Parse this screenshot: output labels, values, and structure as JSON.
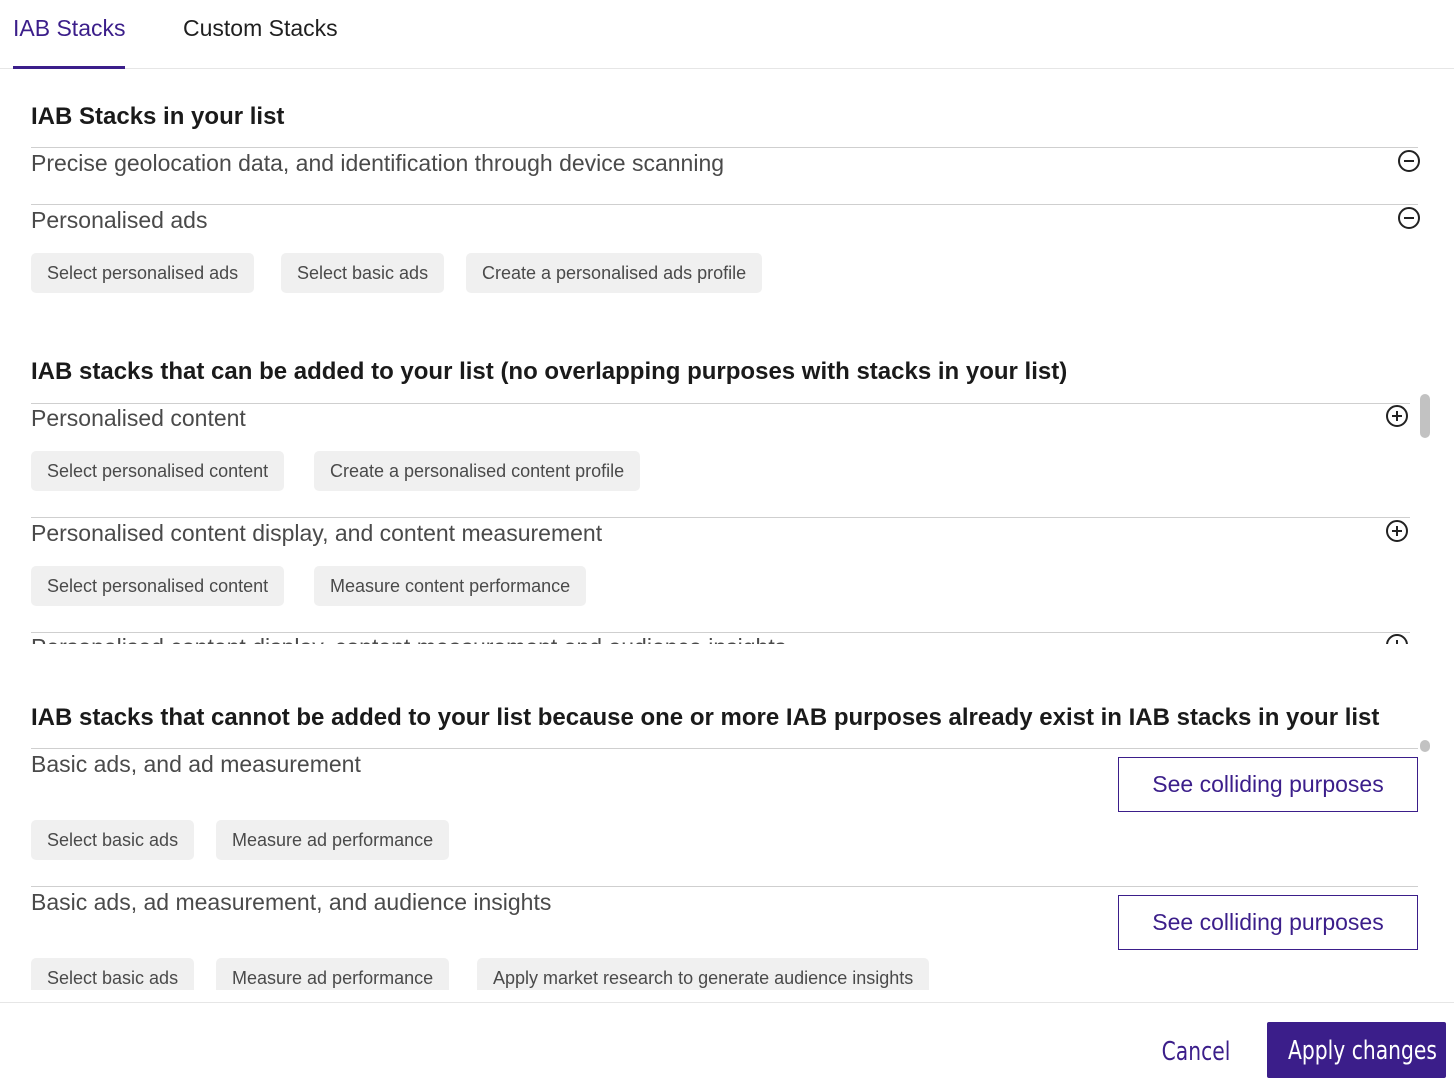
{
  "tabs": [
    {
      "label": "IAB Stacks",
      "active": true
    },
    {
      "label": "Custom Stacks",
      "active": false
    }
  ],
  "in_list": {
    "title": "IAB Stacks in your list",
    "stacks": [
      {
        "name": "Precise geolocation data, and identification through device scanning",
        "action_icon": "minus-circle-icon",
        "purposes": []
      },
      {
        "name": "Personalised ads",
        "action_icon": "minus-circle-icon",
        "purposes": [
          "Select personalised ads",
          "Select basic ads",
          "Create a personalised ads profile"
        ]
      }
    ]
  },
  "can_add": {
    "title": "IAB stacks that can be added to your list (no overlapping purposes with stacks in your list)",
    "stacks": [
      {
        "name": "Personalised content",
        "action_icon": "plus-circle-icon",
        "purposes": [
          "Select personalised content",
          "Create a personalised content profile"
        ]
      },
      {
        "name": "Personalised content display, and content measurement",
        "action_icon": "plus-circle-icon",
        "purposes": [
          "Select personalised content",
          "Measure content performance"
        ]
      },
      {
        "name": "Personalised content display, content measurement and audience insights",
        "action_icon": "plus-circle-icon",
        "purposes": []
      }
    ]
  },
  "cannot_add": {
    "title": "IAB stacks that cannot be added to your list because one or more IAB purposes already exist in IAB stacks in your list",
    "button_label": "See colliding purposes",
    "stacks": [
      {
        "name": "Basic ads, and ad measurement",
        "purposes": [
          "Select basic ads",
          "Measure ad performance"
        ]
      },
      {
        "name": "Basic ads, ad measurement, and audience insights",
        "purposes": [
          "Select basic ads",
          "Measure ad performance",
          "Apply market research to generate audience insights"
        ]
      }
    ]
  },
  "footer": {
    "cancel_label": "Cancel",
    "apply_label": "Apply changes"
  },
  "colors": {
    "accent": "#3b1e8a",
    "chip_bg": "#f0f0f0",
    "divider": "#cfcfcf"
  }
}
